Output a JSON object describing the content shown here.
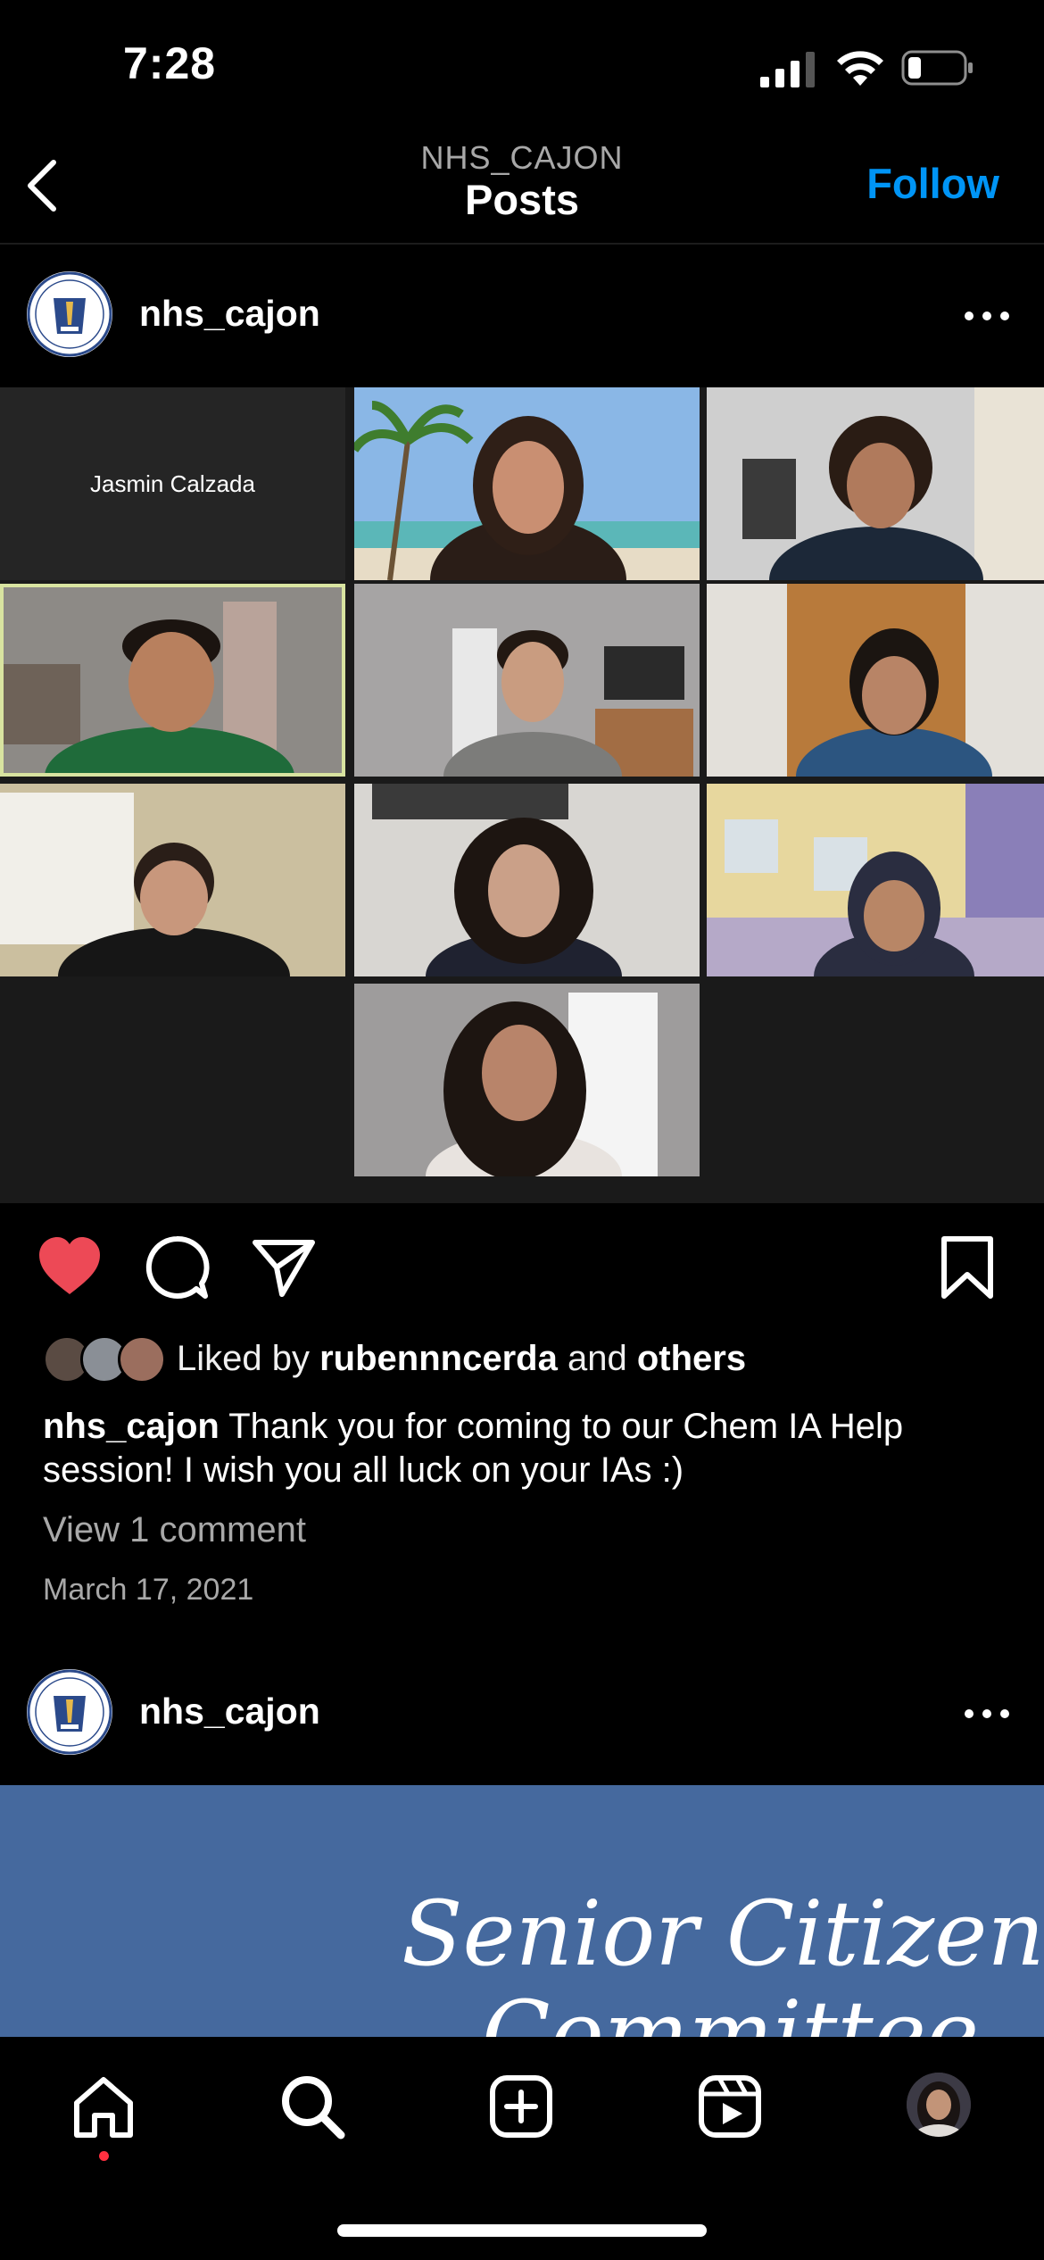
{
  "status_bar": {
    "time": "7:28",
    "icons": [
      "cellular-signal-icon",
      "wifi-icon",
      "battery-icon"
    ]
  },
  "nav": {
    "subtitle": "NHS_CAJON",
    "title": "Posts",
    "follow_label": "Follow",
    "back_icon": "chevron-left-icon"
  },
  "post1": {
    "username": "nhs_cajon",
    "zoom_tile_name": "Jasmin Calzada",
    "liked_prefix": "Liked by",
    "liked_user": "rubennncerda",
    "liked_and": "and",
    "liked_others": "others",
    "caption_user": "nhs_cajon",
    "caption_text": "Thank you for coming to our Chem IA Help session! I wish you all luck on your IAs :)",
    "view_comments": "View 1 comment",
    "date": "March 17, 2021",
    "liked": true,
    "action_icons": [
      "heart-icon",
      "comment-icon",
      "share-icon",
      "bookmark-icon"
    ]
  },
  "post2": {
    "username": "nhs_cajon",
    "banner_text_line1": "Senior Citizen",
    "banner_text_line2": "Committee"
  },
  "tabbar": {
    "icons": [
      "home-icon",
      "search-icon",
      "create-post-icon",
      "reels-icon",
      "profile-avatar"
    ]
  },
  "colors": {
    "accent": "#0095f6",
    "like_red": "#ed4956",
    "notification_dot": "#ff3040",
    "banner_blue": "#45699e"
  }
}
